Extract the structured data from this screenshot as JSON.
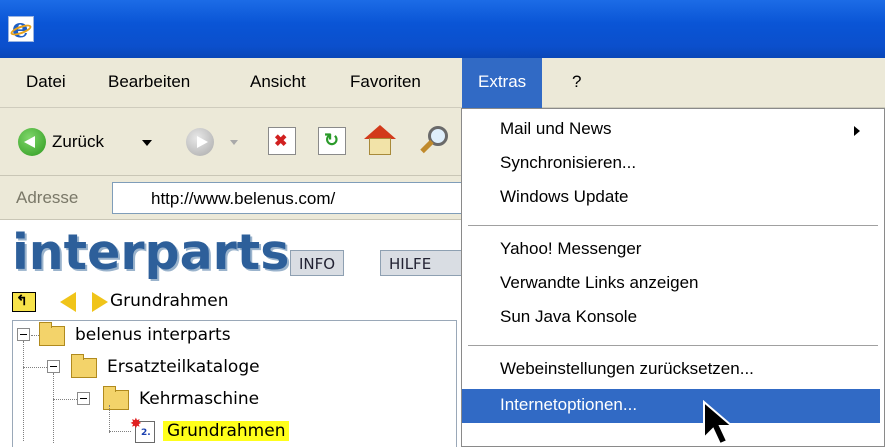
{
  "menubar": {
    "items": [
      "Datei",
      "Bearbeiten",
      "Ansicht",
      "Favoriten",
      "Extras",
      "?"
    ],
    "active": "Extras"
  },
  "toolbar": {
    "back_label": "Zurück"
  },
  "address": {
    "label": "Adresse",
    "url": "http://www.belenus.com/"
  },
  "content": {
    "logo": "interparts",
    "info_button": "INFO",
    "hilfe_button": "HILFE",
    "breadcrumb": "Grundrahmen",
    "tree": [
      {
        "label": "belenus interparts"
      },
      {
        "label": "Ersatzteilkataloge"
      },
      {
        "label": "Kehrmaschine"
      },
      {
        "label": "Grundrahmen",
        "highlighted": true
      }
    ]
  },
  "extras_menu": {
    "items": [
      {
        "label": "Mail und News",
        "submenu": true
      },
      {
        "label": "Synchronisieren..."
      },
      {
        "label": "Windows Update"
      },
      {
        "label": "Yahoo! Messenger"
      },
      {
        "label": "Verwandte Links anzeigen"
      },
      {
        "label": "Sun Java Konsole"
      },
      {
        "label": "Webeinstellungen zurücksetzen..."
      },
      {
        "label": "Internetoptionen...",
        "highlighted": true
      }
    ]
  },
  "colors": {
    "titlebar": "#0b4fcc",
    "menu_highlight": "#316ac5",
    "logo_text": "#2d5f9a",
    "tree_highlight": "#ffff1a"
  }
}
